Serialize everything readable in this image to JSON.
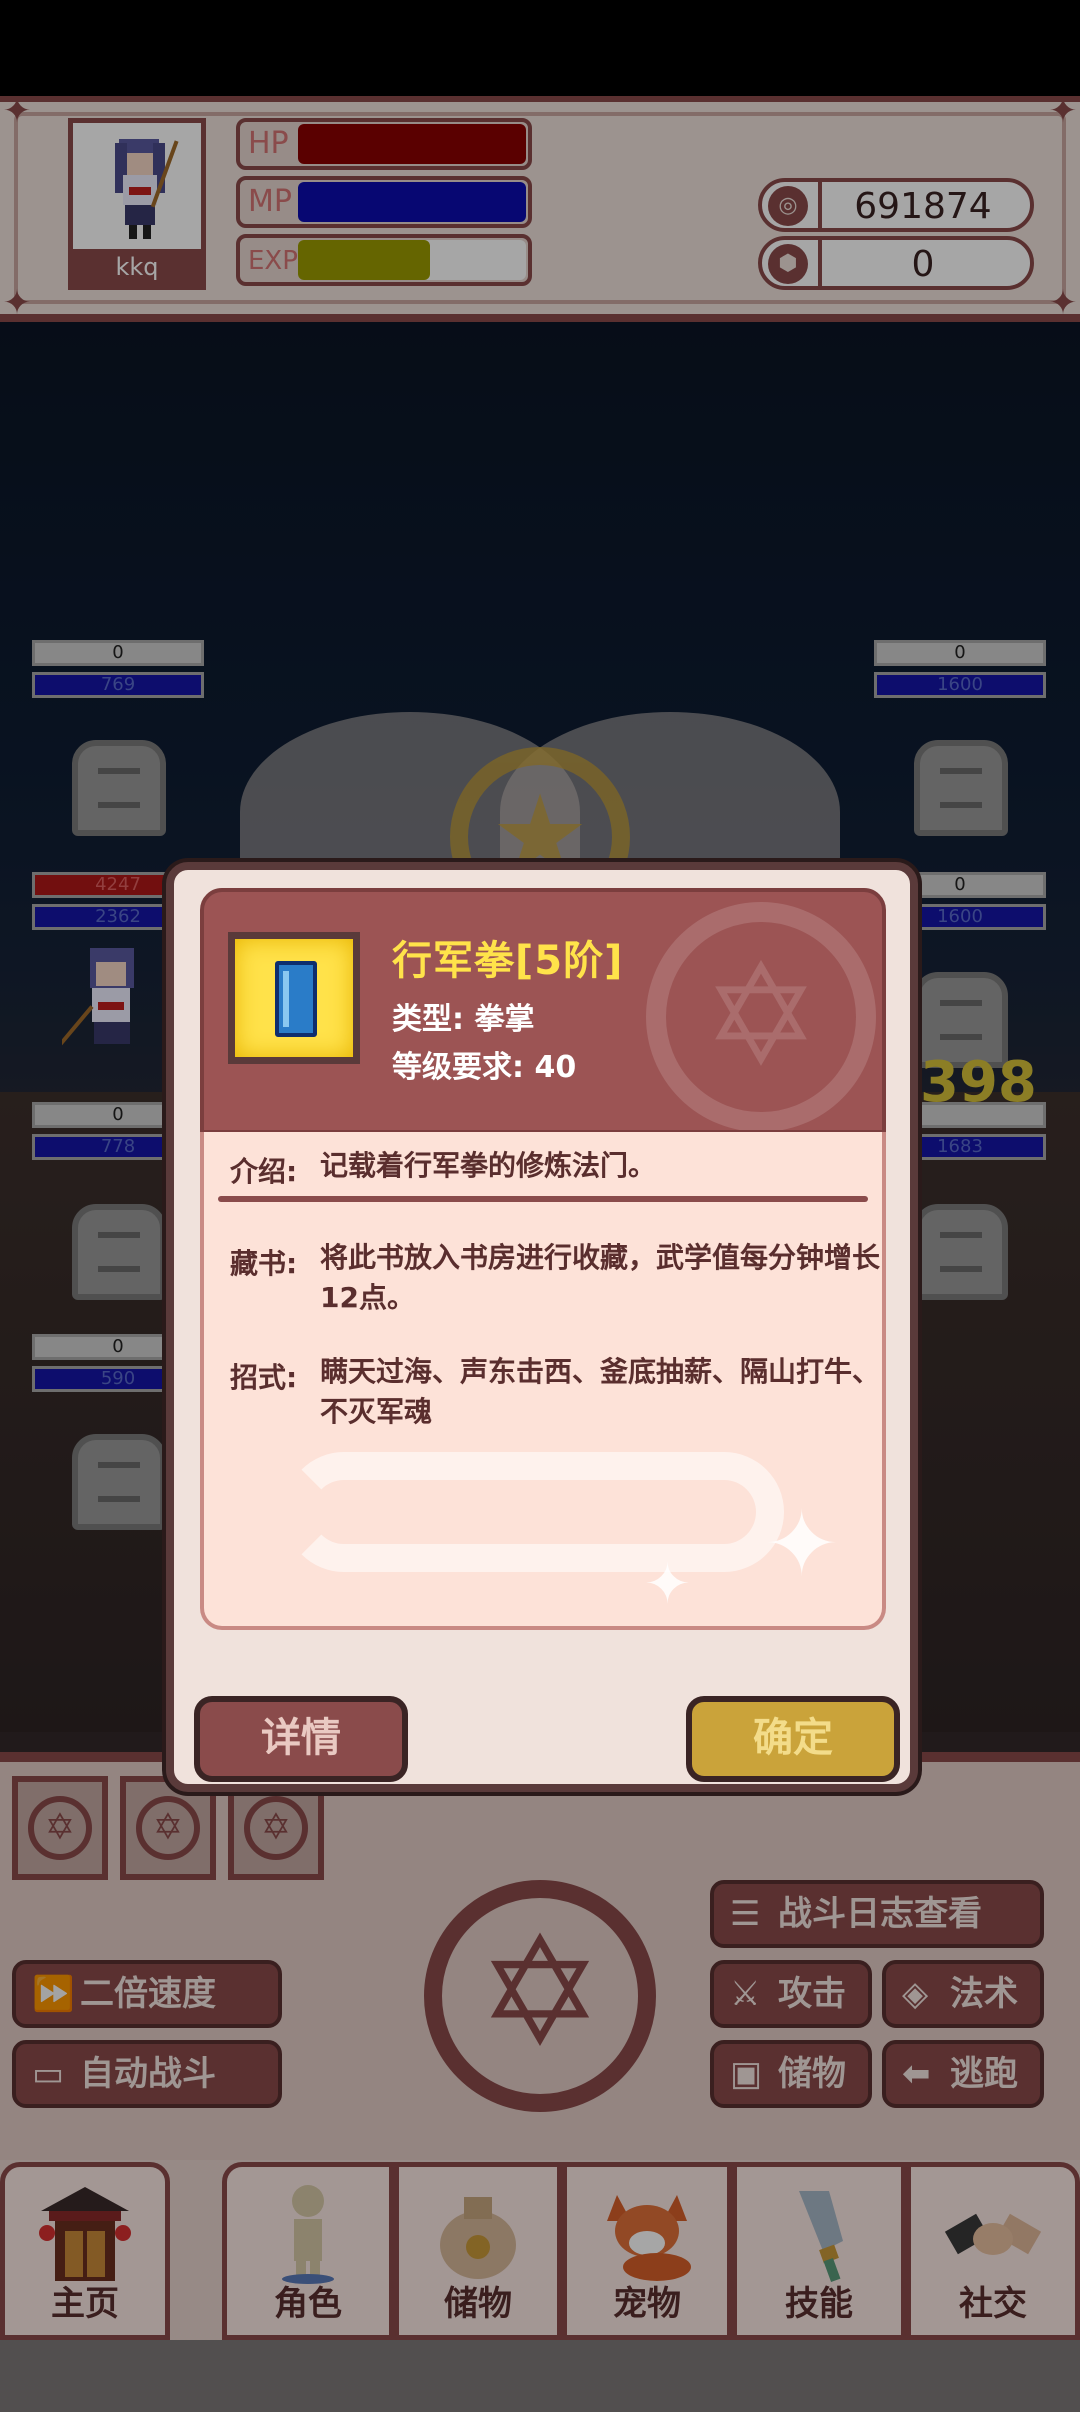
{
  "player": {
    "name": "kkq"
  },
  "stats": {
    "hp_label": "HP",
    "mp_label": "MP",
    "exp_label": "EXP",
    "hp": 1.0,
    "mp": 1.0,
    "exp": 0.58
  },
  "currency": {
    "coins": "691874",
    "gems": "0"
  },
  "battle": {
    "left_units": [
      {
        "top": "0",
        "bottom": "769"
      },
      {
        "top": "4247",
        "bottom": "2362"
      },
      {
        "top": "0",
        "bottom": "778"
      },
      {
        "top": "0",
        "bottom": "590"
      }
    ],
    "right_units": [
      {
        "top": "0",
        "bottom": "1600"
      },
      {
        "top": "0",
        "bottom": "1600"
      },
      {
        "top": "0",
        "bottom": "1683"
      }
    ],
    "damage_popup": "398"
  },
  "dialog": {
    "title": "行军拳[5阶]",
    "type": "类型: 拳掌",
    "level_req": "等级要求: 40",
    "intro_label": "介绍:",
    "intro_text": "记载着行军拳的修炼法门。",
    "collect_label": "藏书:",
    "collect_text": "将此书放入书房进行收藏，武学值每分钟增长12点。",
    "moves_label": "招式:",
    "moves_text": "瞒天过海、声东击西、釜底抽薪、隔山打牛、不灭军魂",
    "detail_button": "详情",
    "confirm_button": "确定"
  },
  "controls": {
    "battle_log": "战斗日志查看",
    "double_speed": "二倍速度",
    "auto_battle": "自动战斗",
    "attack": "攻击",
    "magic": "法术",
    "storage": "储物",
    "escape": "逃跑"
  },
  "nav": {
    "home": "主页",
    "character": "角色",
    "storage": "储物",
    "pet": "宠物",
    "skill": "技能",
    "social": "社交"
  },
  "colors": {
    "accent": "#8a4b4b",
    "hp": "#8a0000",
    "mp": "#0c0cb0",
    "exp": "#9c9c00",
    "title": "#ffe34a"
  }
}
